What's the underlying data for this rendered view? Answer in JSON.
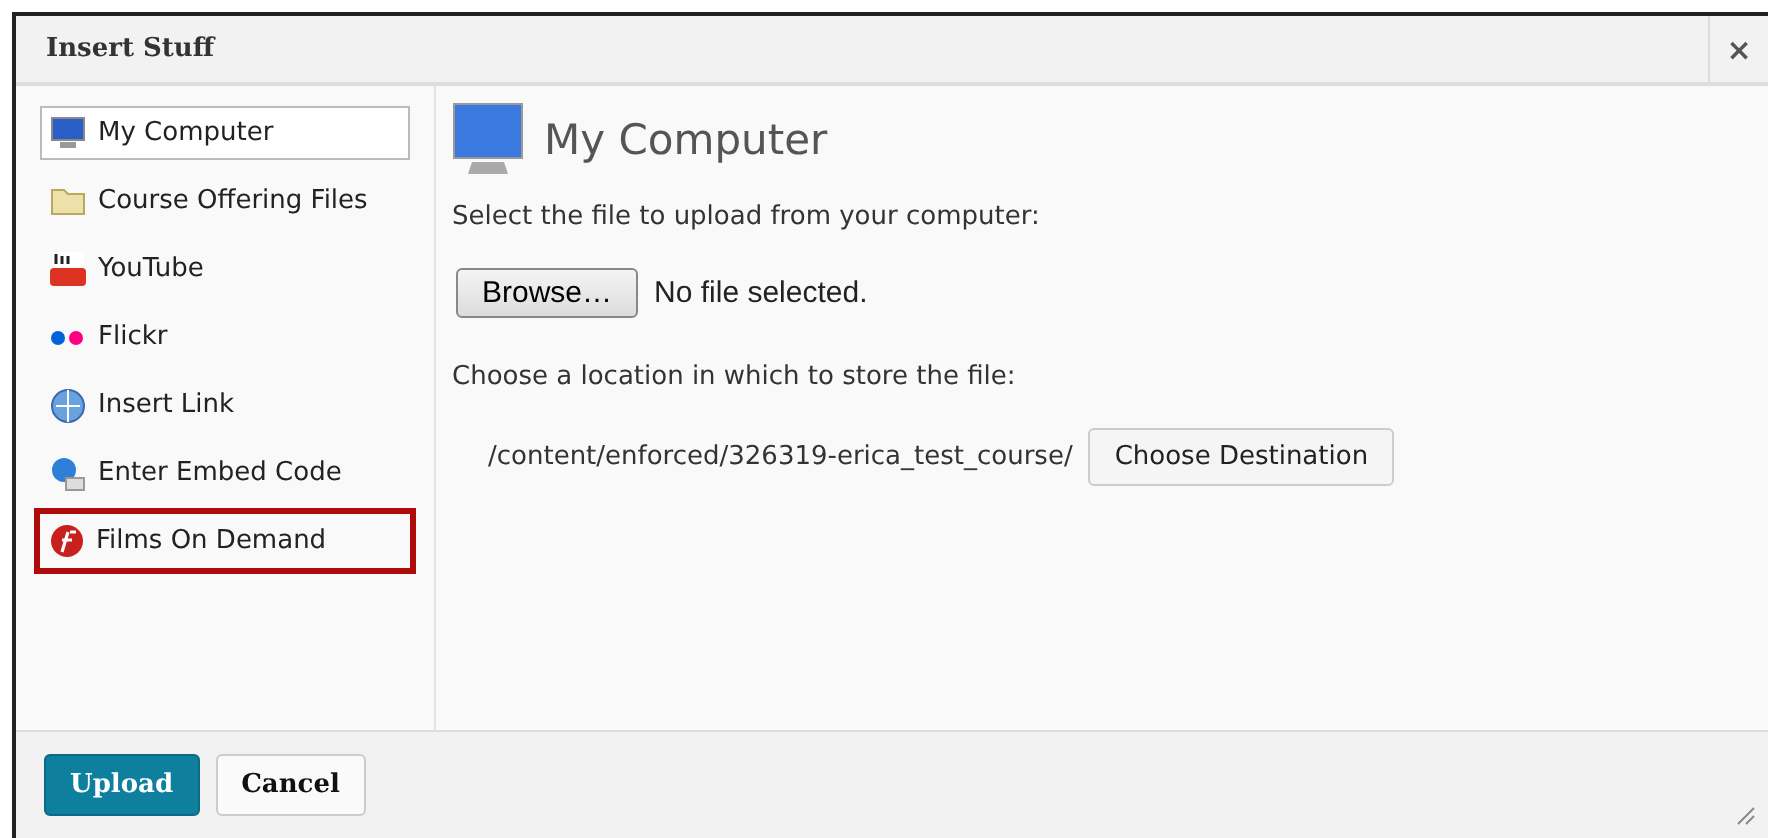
{
  "window": {
    "title": "Insert Stuff",
    "close": "×"
  },
  "sidebar": {
    "items": [
      {
        "label": "My Computer",
        "kind": "computer",
        "selected": true,
        "highlighted": false
      },
      {
        "label": "Course Offering Files",
        "kind": "folder",
        "selected": false,
        "highlighted": false
      },
      {
        "label": "YouTube",
        "kind": "youtube",
        "selected": false,
        "highlighted": false
      },
      {
        "label": "Flickr",
        "kind": "flickr",
        "selected": false,
        "highlighted": false
      },
      {
        "label": "Insert Link",
        "kind": "link",
        "selected": false,
        "highlighted": false
      },
      {
        "label": "Enter Embed Code",
        "kind": "embed",
        "selected": false,
        "highlighted": false
      },
      {
        "label": "Films On Demand",
        "kind": "films",
        "selected": false,
        "highlighted": true
      }
    ]
  },
  "main": {
    "heading": "My Computer",
    "upload_prompt": "Select the file to upload from your computer:",
    "browse_button": "Browse…",
    "file_status": "No file selected.",
    "location_prompt": "Choose a location in which to store the file:",
    "path": "/content/enforced/326319-erica_test_course/",
    "destination_button": "Choose Destination"
  },
  "footer": {
    "buttons": [
      {
        "label": "Upload",
        "kind": "primary"
      },
      {
        "label": "Cancel",
        "kind": "secondary"
      }
    ]
  }
}
